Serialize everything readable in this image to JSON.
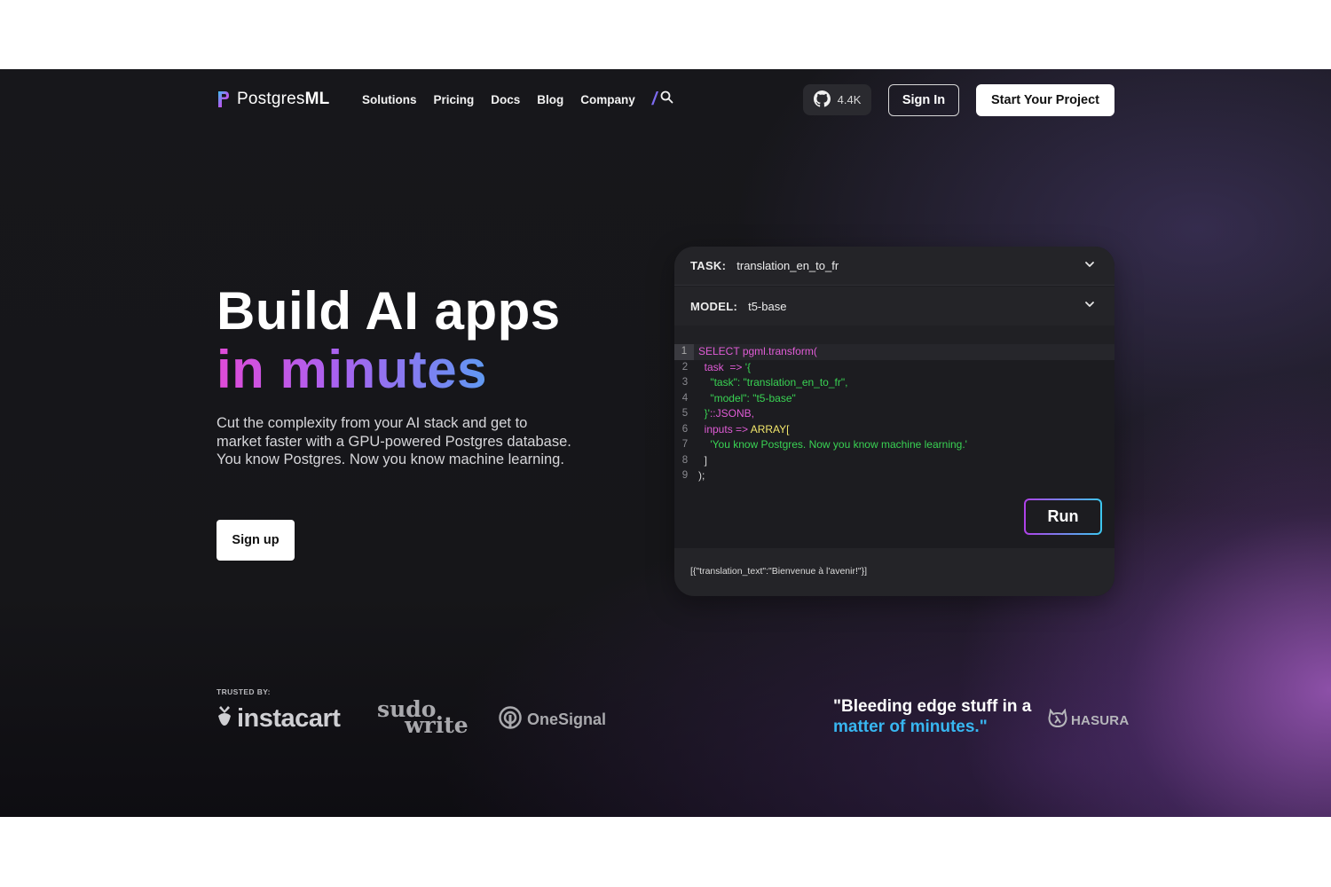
{
  "brand": {
    "name_light": "Postgres",
    "name_bold": "ML"
  },
  "nav": {
    "links": [
      "Solutions",
      "Pricing",
      "Docs",
      "Blog",
      "Company"
    ],
    "search_slash": "/",
    "github_stars": "4.4K",
    "sign_in": "Sign In",
    "start_project": "Start Your Project"
  },
  "hero": {
    "title_line1": "Build AI apps",
    "title_line2": "in minutes",
    "description": "Cut the complexity from your AI stack and get to market faster with a GPU-powered Postgres database. You know Postgres. Now you know machine learning.",
    "signup": "Sign up"
  },
  "demo": {
    "task_label": "TASK:",
    "task_value": "translation_en_to_fr",
    "model_label": "MODEL:",
    "model_value": "t5-base",
    "code_lines": [
      {
        "n": "1",
        "segments": [
          [
            "kw",
            "SELECT "
          ],
          [
            "fn",
            "pgml.transform("
          ]
        ]
      },
      {
        "n": "2",
        "segments": [
          [
            "kw",
            "  task  "
          ],
          [
            "op",
            "=> "
          ],
          [
            "str",
            "'{"
          ]
        ]
      },
      {
        "n": "3",
        "segments": [
          [
            "str",
            "    \"task\": \"translation_en_to_fr\","
          ]
        ]
      },
      {
        "n": "4",
        "segments": [
          [
            "str",
            "    \"model\": \"t5-base\""
          ]
        ]
      },
      {
        "n": "5",
        "segments": [
          [
            "str",
            "  }'"
          ],
          [
            "kw",
            "::JSONB,"
          ]
        ]
      },
      {
        "n": "6",
        "segments": [
          [
            "kw",
            "  inputs "
          ],
          [
            "op",
            "=> "
          ],
          [
            "arr",
            "ARRAY["
          ]
        ]
      },
      {
        "n": "7",
        "segments": [
          [
            "str",
            "    'You know Postgres. Now you know machine learning.'"
          ]
        ]
      },
      {
        "n": "8",
        "segments": [
          [
            "pl",
            "  ]"
          ]
        ]
      },
      {
        "n": "9",
        "segments": [
          [
            "pl",
            ");"
          ]
        ]
      }
    ],
    "run": "Run",
    "result": "[{\"translation_text\":\"Bienvenue à l'avenir!\"}]"
  },
  "trusted": {
    "label": "TRUSTED BY:",
    "instacart": "instacart",
    "sudo_top": "sudo",
    "sudo_bottom": "write",
    "onesignal": "OneSignal",
    "hasura": "HASURA"
  },
  "quote": {
    "line1": "\"Bleeding edge stuff in a",
    "line2": "matter of minutes.\""
  },
  "colors": {
    "accent_gradient_start": "#e04bd8",
    "accent_gradient_end": "#3cc0f0",
    "quote_blue": "#38b6f0",
    "background": "#17171b"
  }
}
